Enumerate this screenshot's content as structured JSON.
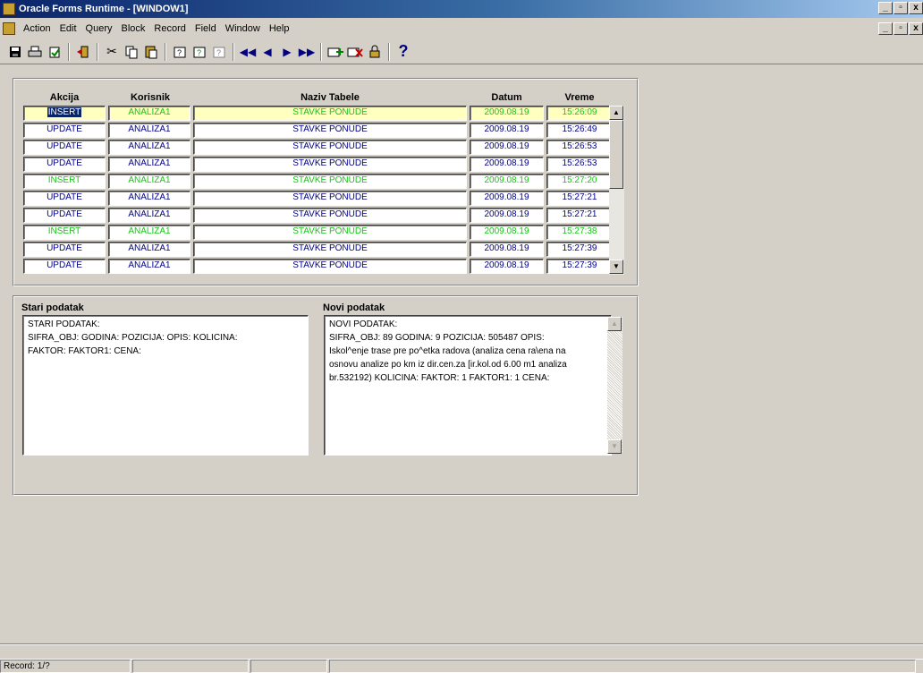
{
  "window": {
    "title": "Oracle Forms Runtime - [WINDOW1]",
    "controls": [
      "_",
      "ə",
      "x"
    ]
  },
  "menu": [
    "Action",
    "Edit",
    "Query",
    "Block",
    "Record",
    "Field",
    "Window",
    "Help"
  ],
  "toolbar": {
    "icons": [
      "save-icon",
      "print-icon",
      "clear-icon",
      "exit-icon",
      "cut-icon",
      "copy-icon",
      "paste-icon",
      "enter-query-icon",
      "execute-query-icon",
      "cancel-query-icon",
      "first-record-icon",
      "previous-record-icon",
      "next-record-icon",
      "last-record-icon",
      "insert-record-icon",
      "delete-record-icon",
      "lock-record-icon",
      "help-icon"
    ],
    "help_label": "?"
  },
  "grid": {
    "headers": {
      "akcija": "Akcija",
      "korisnik": "Korisnik",
      "naziv": "Naziv Tabele",
      "datum": "Datum",
      "vreme": "Vreme"
    },
    "rows": [
      {
        "akcija": "INSERT",
        "korisnik": "ANALIZA1",
        "naziv": "STAVKE PONUDE",
        "datum": "2009.08.19",
        "vreme": "15:26:09"
      },
      {
        "akcija": "UPDATE",
        "korisnik": "ANALIZA1",
        "naziv": "STAVKE PONUDE",
        "datum": "2009.08.19",
        "vreme": "15:26:49"
      },
      {
        "akcija": "UPDATE",
        "korisnik": "ANALIZA1",
        "naziv": "STAVKE PONUDE",
        "datum": "2009.08.19",
        "vreme": "15:26:53"
      },
      {
        "akcija": "UPDATE",
        "korisnik": "ANALIZA1",
        "naziv": "STAVKE PONUDE",
        "datum": "2009.08.19",
        "vreme": "15:26:53"
      },
      {
        "akcija": "INSERT",
        "korisnik": "ANALIZA1",
        "naziv": "STAVKE PONUDE",
        "datum": "2009.08.19",
        "vreme": "15:27:20"
      },
      {
        "akcija": "UPDATE",
        "korisnik": "ANALIZA1",
        "naziv": "STAVKE PONUDE",
        "datum": "2009.08.19",
        "vreme": "15:27:21"
      },
      {
        "akcija": "UPDATE",
        "korisnik": "ANALIZA1",
        "naziv": "STAVKE PONUDE",
        "datum": "2009.08.19",
        "vreme": "15:27:21"
      },
      {
        "akcija": "INSERT",
        "korisnik": "ANALIZA1",
        "naziv": "STAVKE PONUDE",
        "datum": "2009.08.19",
        "vreme": "15:27:38"
      },
      {
        "akcija": "UPDATE",
        "korisnik": "ANALIZA1",
        "naziv": "STAVKE PONUDE",
        "datum": "2009.08.19",
        "vreme": "15:27:39"
      },
      {
        "akcija": "UPDATE",
        "korisnik": "ANALIZA1",
        "naziv": "STAVKE PONUDE",
        "datum": "2009.08.19",
        "vreme": "15:27:39"
      }
    ],
    "colors": {
      "insert": "#12c812",
      "update": "#00008b",
      "current_row": "#ffffc0"
    }
  },
  "detail": {
    "stari_label": "Stari podatak",
    "novi_label": "Novi podatak",
    "stari_lines": [
      "STARI PODATAK:",
      "   SIFRA_OBJ:  GODINA:  POZICIJA:  OPIS:  KOLICINA:",
      "FAKTOR:  FAKTOR1:  CENA:"
    ],
    "novi_lines": [
      "NOVI PODATAK:",
      "   SIFRA_OBJ: 89 GODINA: 9 POZICIJA: 505487 OPIS:",
      "Iskol^enje trase pre po^etka radova (analiza cena ra\\ena na",
      "osnovu analize po km iz dir.cen.za [ir.kol.od 6.00 m1 analiza",
      "br.532192) KOLICINA:  FAKTOR: 1 FAKTOR1: 1 CENA:"
    ]
  },
  "status": {
    "record": "Record: 1/?"
  }
}
